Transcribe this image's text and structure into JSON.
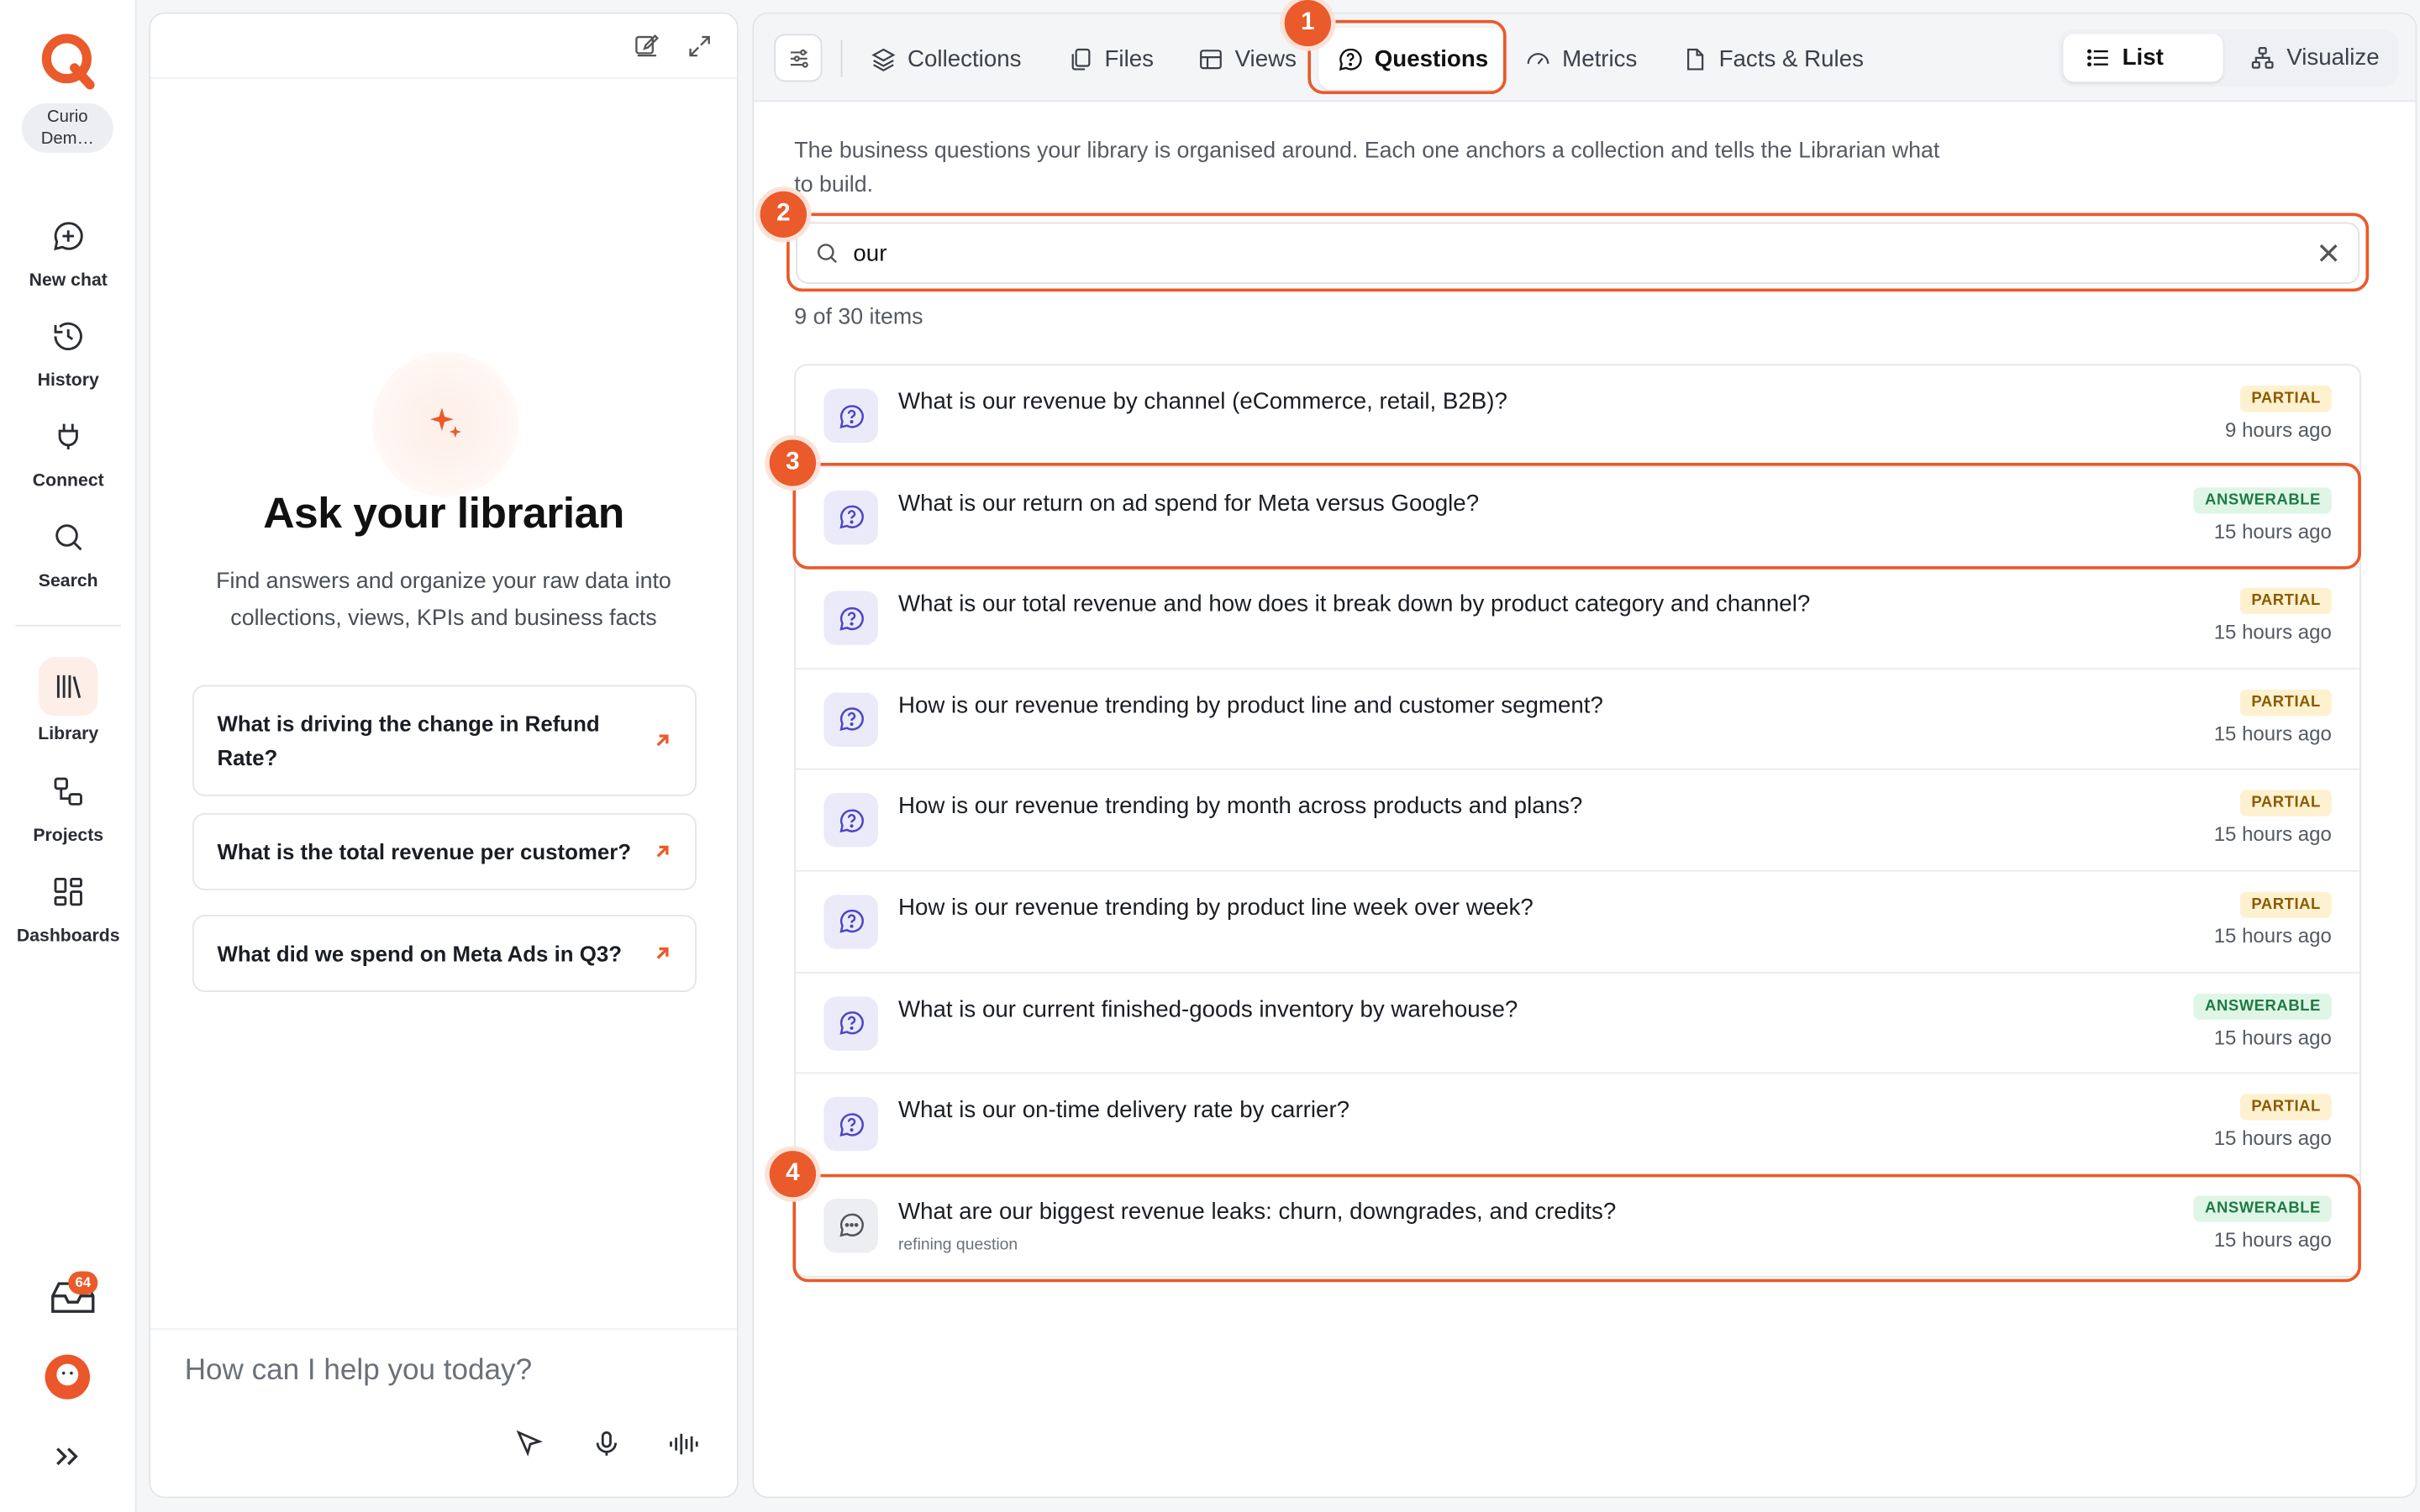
{
  "org": {
    "name": "Curio Dem…",
    "name_line1": "Curio",
    "name_line2": "Dem…"
  },
  "nav": {
    "new_chat": "New chat",
    "history": "History",
    "connect": "Connect",
    "search": "Search",
    "library": "Library",
    "projects": "Projects",
    "dashboards": "Dashboards",
    "inbox_count": "64"
  },
  "chat": {
    "title": "Ask your librarian",
    "subtitle": "Find answers and organize your raw data into collections, views, KPIs and business facts",
    "suggestions": [
      "What is driving the change in Refund Rate?",
      "What is the total revenue per customer?",
      "What did we spend on Meta Ads in Q3?"
    ],
    "composer_placeholder": "How can I help you today?"
  },
  "library": {
    "tabs": [
      "Collections",
      "Files",
      "Views",
      "Questions",
      "Metrics",
      "Facts & Rules"
    ],
    "active_tab": "Questions",
    "view_modes": [
      "List",
      "Visualize"
    ],
    "active_view": "List",
    "description": "The business questions your library is organised around. Each one anchors a collection and tells the Librarian what to build.",
    "search_value": "our",
    "item_count": "9 of 30 items",
    "questions": [
      {
        "text": "What is our revenue by channel (eCommerce, retail, B2B)?",
        "status": "PARTIAL",
        "time": "9 hours ago"
      },
      {
        "text": "What is our return on ad spend for Meta versus Google?",
        "status": "ANSWERABLE",
        "time": "15 hours ago"
      },
      {
        "text": "What is our total revenue and how does it break down by product category and channel?",
        "status": "PARTIAL",
        "time": "15 hours ago"
      },
      {
        "text": "How is our revenue trending by product line and customer segment?",
        "status": "PARTIAL",
        "time": "15 hours ago"
      },
      {
        "text": "How is our revenue trending by month across products and plans?",
        "status": "PARTIAL",
        "time": "15 hours ago"
      },
      {
        "text": "How is our revenue trending by product line week over week?",
        "status": "PARTIAL",
        "time": "15 hours ago"
      },
      {
        "text": "What is our current finished-goods inventory by warehouse?",
        "status": "ANSWERABLE",
        "time": "15 hours ago"
      },
      {
        "text": "What is our on-time delivery rate by carrier?",
        "status": "PARTIAL",
        "time": "15 hours ago"
      },
      {
        "text": "What are our biggest revenue leaks: churn, downgrades, and credits?",
        "subtext": "refining question",
        "status": "ANSWERABLE",
        "time": "15 hours ago"
      }
    ]
  },
  "annotations": [
    "1",
    "2",
    "3",
    "4"
  ],
  "colors": {
    "accent": "#ea5a2a",
    "question_icon": "#4b45c9",
    "partial": "#8a5a00",
    "answerable": "#1e7a43"
  }
}
